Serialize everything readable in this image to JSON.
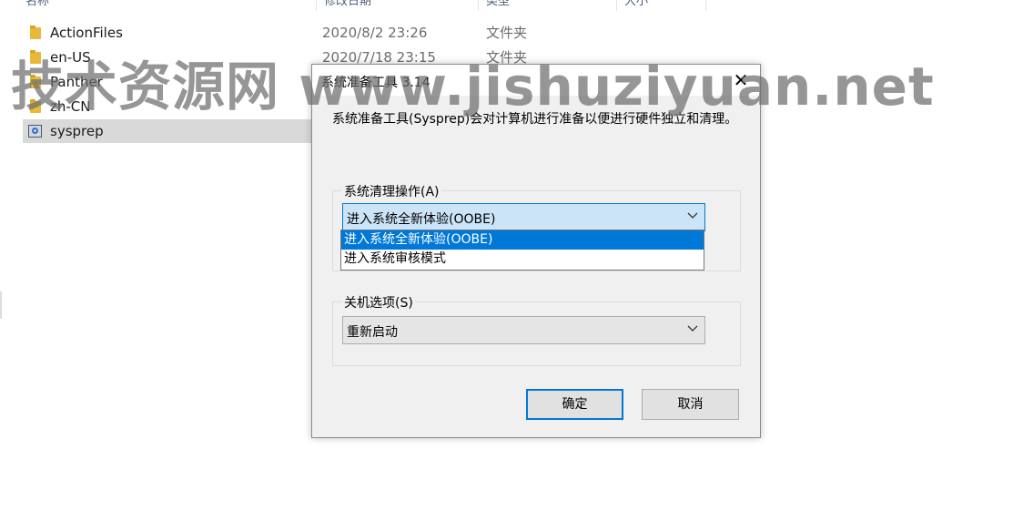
{
  "explorer": {
    "columns": [
      "名称",
      "修改日期",
      "类型",
      "大小"
    ],
    "files": [
      {
        "name": "ActionFiles",
        "date": "2020/8/2 23:26",
        "type": "文件夹",
        "icon": "folder-icon"
      },
      {
        "name": "en-US",
        "date": "2020/7/18 23:15",
        "type": "文件夹",
        "icon": "folder-icon"
      },
      {
        "name": "Panther",
        "date": "",
        "type": "",
        "icon": "folder-icon"
      },
      {
        "name": "zh-CN",
        "date": "",
        "type": "",
        "icon": "folder-icon"
      },
      {
        "name": "sysprep",
        "date": "",
        "type": "",
        "icon": "app-icon"
      }
    ]
  },
  "watermark": "技术资源网 www.jishuziyuan.net",
  "dialog": {
    "title": "系统准备工具 3.14",
    "close": "✕",
    "description": "系统准备工具(Sysprep)会对计算机进行准备以便进行硬件独立和清理。",
    "cleanup_group_label": "系统清理操作(A)",
    "cleanup_selected": "进入系统全新体验(OOBE)",
    "cleanup_options": [
      "进入系统全新体验(OOBE)",
      "进入系统审核模式"
    ],
    "shutdown_group_label": "关机选项(S)",
    "shutdown_selected": "重新启动",
    "ok_label": "确定",
    "cancel_label": "取消"
  },
  "colors": {
    "accent": "#0078d7",
    "selection": "#cce4f7",
    "folder": "#e9b839"
  }
}
